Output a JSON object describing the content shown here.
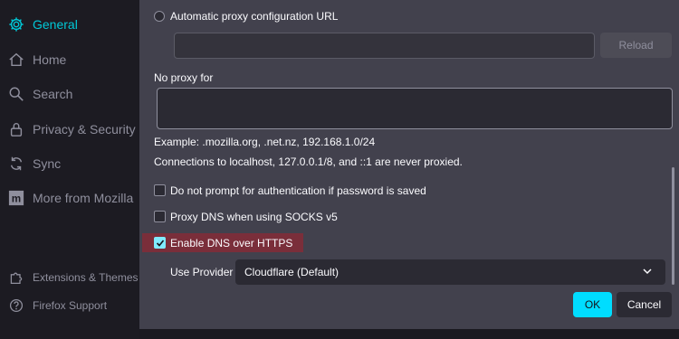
{
  "sidebar": {
    "items": [
      {
        "label": "General",
        "icon": "gear-icon",
        "active": true
      },
      {
        "label": "Home",
        "icon": "home-icon"
      },
      {
        "label": "Search",
        "icon": "search-icon"
      },
      {
        "label": "Privacy & Security",
        "icon": "lock-icon"
      },
      {
        "label": "Sync",
        "icon": "sync-icon"
      },
      {
        "label": "More from Mozilla",
        "icon": "mozilla-icon"
      }
    ],
    "footer": [
      {
        "label": "Extensions & Themes",
        "icon": "puzzle-icon"
      },
      {
        "label": "Firefox Support",
        "icon": "help-icon"
      }
    ]
  },
  "dialog": {
    "auto_proxy_label": "Automatic proxy configuration URL",
    "auto_proxy_url": "",
    "reload_label": "Reload",
    "no_proxy_label": "No proxy for",
    "no_proxy_value": "",
    "example_text": "Example: .mozilla.org, .net.nz, 192.168.1.0/24",
    "localhost_note": "Connections to localhost, 127.0.0.1/8, and ::1 are never proxied.",
    "checkboxes": [
      {
        "label": "Do not prompt for authentication if password is saved",
        "checked": false
      },
      {
        "label": "Proxy DNS when using SOCKS v5",
        "checked": false
      },
      {
        "label": "Enable DNS over HTTPS",
        "checked": true
      }
    ],
    "use_provider_label": "Use Provider",
    "provider_value": "Cloudflare (Default)",
    "ok_label": "OK",
    "cancel_label": "Cancel"
  },
  "colors": {
    "accent": "#00c8d7",
    "ok_button": "#00ddff",
    "highlight": "#7a2e3a"
  }
}
